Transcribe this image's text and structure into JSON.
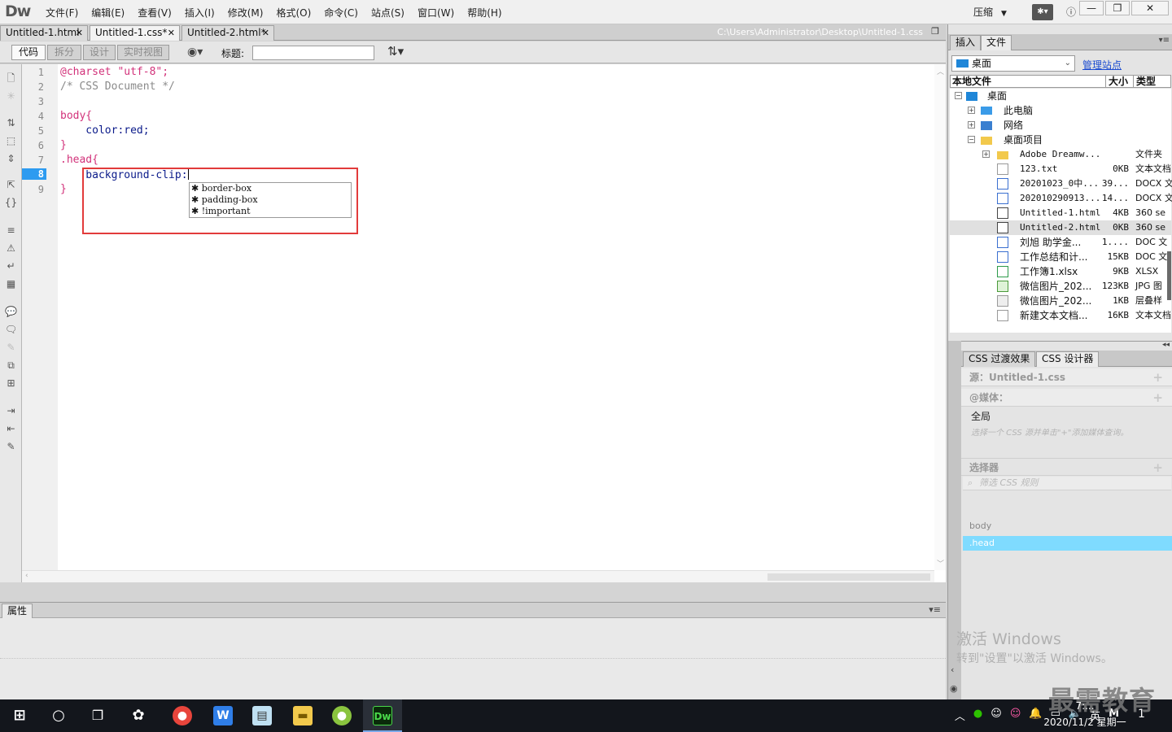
{
  "app": {
    "logo": "Dw",
    "menus": [
      "文件(F)",
      "编辑(E)",
      "查看(V)",
      "插入(I)",
      "修改(M)",
      "格式(O)",
      "命令(C)",
      "站点(S)",
      "窗口(W)",
      "帮助(H)"
    ],
    "workspace": "压缩"
  },
  "doc_tabs": [
    {
      "label": "Untitled-1.html"
    },
    {
      "label": "Untitled-1.css*"
    },
    {
      "label": "Untitled-2.html*"
    }
  ],
  "file_path": "C:\\Users\\Administrator\\Desktop\\Untitled-1.css",
  "toolbar": {
    "code": "代码",
    "split": "拆分",
    "design": "设计",
    "live": "实时视图",
    "title_label": "标题:",
    "title_value": ""
  },
  "editor": {
    "line_numbers": [
      "1",
      "2",
      "3",
      "4",
      "5",
      "6",
      "7",
      "8",
      "9"
    ],
    "current_line": "8",
    "lines": {
      "l1a": "@charset \"utf-8\";",
      "l2": "/* CSS Document */",
      "l4": "body{",
      "l5": "    color:red;",
      "l6": "}",
      "l7": ".head{",
      "l8": "    background-clip:",
      "l9": "}"
    },
    "hints": [
      "border-box",
      "padding-box",
      "!important"
    ]
  },
  "properties": {
    "title": "属性"
  },
  "right_panel": {
    "tabs": [
      "插入",
      "文件"
    ],
    "site": "桌面",
    "manage": "管理站点",
    "columns": {
      "name": "本地文件",
      "size": "大小",
      "type": "类型"
    },
    "tree": [
      {
        "name": "桌面",
        "size": "",
        "type": ""
      },
      {
        "name": "此电脑",
        "size": "",
        "type": ""
      },
      {
        "name": "网络",
        "size": "",
        "type": ""
      },
      {
        "name": "桌面项目",
        "size": "",
        "type": ""
      },
      {
        "name": "Adobe Dreamw...",
        "size": "",
        "type": "文件夹"
      },
      {
        "name": "123.txt",
        "size": "0KB",
        "type": "文本文档"
      },
      {
        "name": "20201023_0中...",
        "size": "39...",
        "type": "DOCX 文"
      },
      {
        "name": "20201029091З...",
        "size": "14...",
        "type": "DOCX 文"
      },
      {
        "name": "Untitled-1.html",
        "size": "4KB",
        "type": "360 se"
      },
      {
        "name": "Untitled-2.html",
        "size": "0KB",
        "type": "360 se"
      },
      {
        "name": "刘旭 助学金...",
        "size": "1....",
        "type": "DOC 文"
      },
      {
        "name": "工作总结和计...",
        "size": "15KB",
        "type": "DOC 文"
      },
      {
        "name": "工作簿1.xlsx",
        "size": "9KB",
        "type": "XLSX"
      },
      {
        "name": "微信图片_202...",
        "size": "123KB",
        "type": "JPG 图"
      },
      {
        "name": "微信图片_202...",
        "size": "1KB",
        "type": "层叠样"
      },
      {
        "name": "新建文本文档...",
        "size": "16KB",
        "type": "文本文档"
      }
    ],
    "css_tabs": [
      "CSS 过渡效果",
      "CSS 设计器"
    ],
    "source": "源：Untitled-1.css",
    "media": "@媒体：",
    "media_global": "全局",
    "media_hint": "选择一个 CSS 源并单击\"+\"添加媒体查询。",
    "selectors": "选择器",
    "filter_placeholder": "筛选 CSS 规则",
    "selector_list": [
      "body",
      ".head"
    ]
  },
  "watermark": {
    "line1": "激活 Windows",
    "line2": "转到\"设置\"以激活 Windows。"
  },
  "brand": "最需教育",
  "taskbar": {
    "time": "7:...",
    "date": "2020/11/2 星期一",
    "ime": "英",
    "ime2": "M",
    "notifications": "1"
  },
  "colors": {
    "accent": "#2d9bf0",
    "selection": "#7fdbff",
    "highlight_box": "#e23b3b"
  }
}
